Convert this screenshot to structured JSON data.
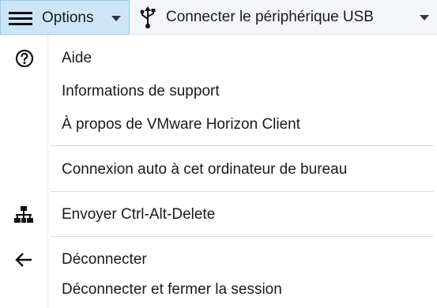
{
  "toolbar": {
    "options_label": "Options",
    "usb_label": "Connecter le périphérique USB"
  },
  "menu": {
    "items": [
      {
        "label": "Aide",
        "icon": "help-circle-icon"
      },
      {
        "label": "Informations de support",
        "icon": ""
      },
      {
        "label": "À propos de VMware Horizon Client",
        "icon": ""
      },
      {
        "label": "Connexion auto à cet ordinateur de bureau",
        "icon": ""
      },
      {
        "label": "Envoyer Ctrl-Alt-Delete",
        "icon": "network-icon"
      },
      {
        "label": "Déconnecter",
        "icon": "arrow-left-icon"
      },
      {
        "label": "Déconnecter et fermer la session",
        "icon": ""
      }
    ]
  },
  "colors": {
    "options_highlight": "#cde6f7",
    "options_border": "#99c9ea",
    "separator": "#d9d9d9"
  }
}
